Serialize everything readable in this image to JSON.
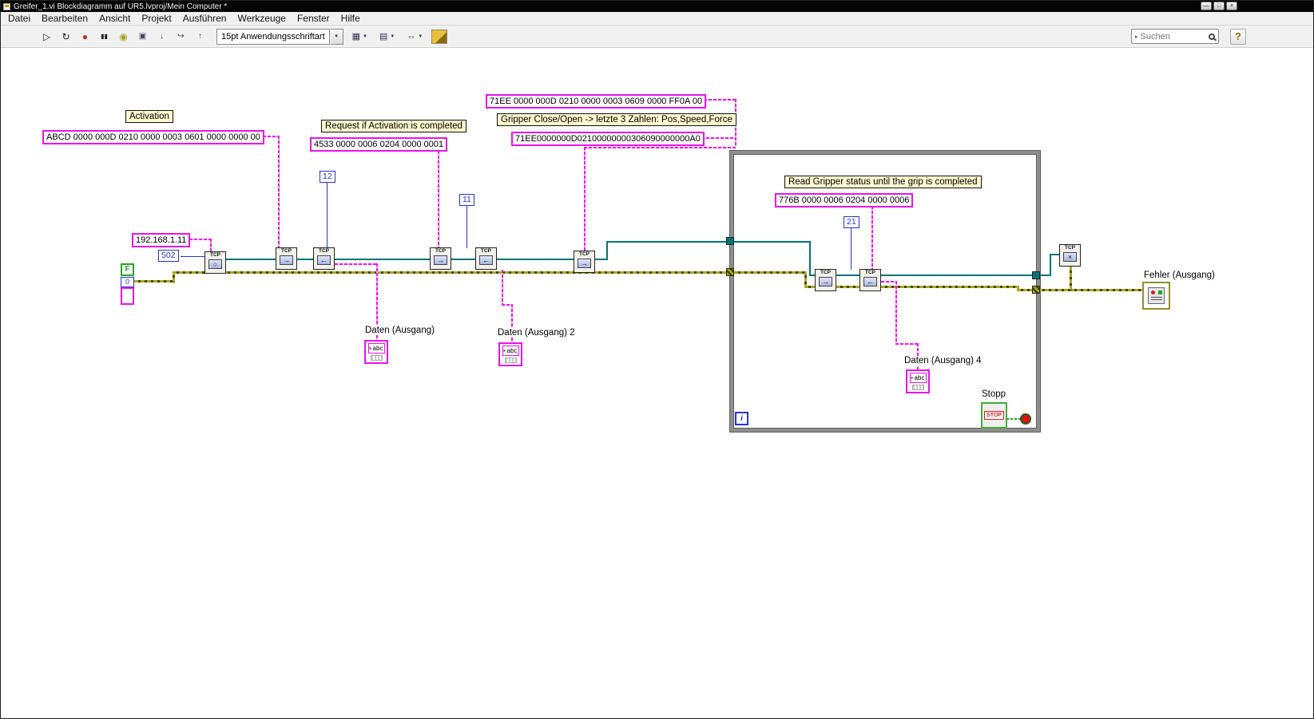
{
  "window": {
    "title": "Greifer_1.vi Blockdiagramm auf UR5.lvproj/Mein Computer *",
    "controls": {
      "minimize": "—",
      "maximize": "□",
      "close": "×"
    }
  },
  "menu": {
    "items": [
      "Datei",
      "Bearbeiten",
      "Ansicht",
      "Projekt",
      "Ausführen",
      "Werkzeuge",
      "Fenster",
      "Hilfe"
    ]
  },
  "toolbar": {
    "font_selector": "15pt Anwendungsschriftart",
    "search_placeholder": "Suchen",
    "help_label": "?",
    "icons": {
      "run": "▷",
      "run_continuous": "↻",
      "abort": "●",
      "pause": "▮▮",
      "highlight_execution": "◉",
      "retain_wire_values": "▣",
      "step_into": "↓",
      "step_over": "↪",
      "step_out": "↑",
      "align_objects": "▦",
      "distribute_objects": "▤",
      "resize_objects": "⇔",
      "dropdown_arrow": "▼"
    }
  },
  "colors": {
    "string_pink": "#e813e8",
    "numeric_blue": "#2634cf",
    "refnum_teal": "#007474",
    "error_olive": "#a9a91c",
    "loop_gray": "#8e8e8e",
    "stop_red": "#cc2222"
  },
  "diagram": {
    "free_labels": {
      "activation": "Activation",
      "request": "Request if Activation is completed",
      "gripper": "Gripper Close/Open -> letzte 3 Zahlen: Pos,Speed,Force",
      "read_status": "Read Gripper status until the grip is completed"
    },
    "string_constants": {
      "activation_cmd": "ABCD 0000 000D 0210 0000 0003 0601 0000 0000 00",
      "request_cmd": "4533 0000 0006 0204 0000 0001",
      "gripper_cmd_spaced": "71EE 0000 000D 0210 0000 0003 0609 0000 FF0A 00",
      "gripper_cmd_compact": "71EE0000000D02100000000306090000000A0",
      "ip_address": "192.168.1.11",
      "status_cmd": "776B 0000 0006 0204 0000 0006"
    },
    "numeric_constants": {
      "port": "502",
      "bytes_12": "12",
      "bytes_11": "11",
      "bytes_21": "21",
      "error_code": "0"
    },
    "boolean_constant": "F",
    "node_tag": "TCP",
    "node_glyphs": {
      "open": "○",
      "write": "→",
      "read": "←",
      "close": "×"
    },
    "indicator_labels": {
      "daten1": "Daten (Ausgang)",
      "daten2": "Daten (Ausgang) 2",
      "daten4": "Daten (Ausgang) 4",
      "fehler": "Fehler (Ausgang)"
    },
    "indicator_glyph": "abc",
    "indicator_arrow": "▸",
    "loop": {
      "iterator": "i"
    },
    "stop": {
      "label": "Stopp",
      "button_text": "STOP"
    }
  }
}
